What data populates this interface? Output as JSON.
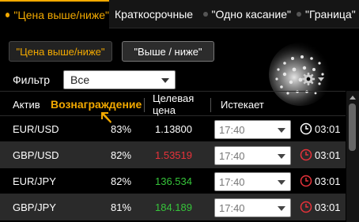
{
  "tabs": [
    {
      "label": "\"Цена выше/ниже\"",
      "active": true
    },
    {
      "label": "Краткосрочные"
    },
    {
      "label": "\"Одно касание\""
    },
    {
      "label": "\"Граница\""
    }
  ],
  "buttons": {
    "primary_label": "\"Цена выше/ниже\"",
    "secondary_label": "\"Выше / ниже\""
  },
  "filter": {
    "label": "Фильтр",
    "value": "Все"
  },
  "table": {
    "headers": {
      "asset": "Актив",
      "reward": "Вознаграждение",
      "price_line1": "Целевая",
      "price_line2": "цена",
      "expires": "Истекает"
    },
    "rows": [
      {
        "asset": "EUR/USD",
        "payout": "83%",
        "price": "1.13800",
        "price_color": "#ffffff",
        "expiry": "17:40",
        "timer": "03:01",
        "timer_icon_color": "#ffffff"
      },
      {
        "asset": "GBP/USD",
        "payout": "82%",
        "price": "1.53519",
        "price_color": "#e8323a",
        "expiry": "17:40",
        "timer": "03:01",
        "timer_icon_color": "#e8323a"
      },
      {
        "asset": "EUR/JPY",
        "payout": "82%",
        "price": "136.534",
        "price_color": "#36c43a",
        "expiry": "17:40",
        "timer": "03:01",
        "timer_icon_color": "#e8323a"
      },
      {
        "asset": "GBP/JPY",
        "payout": "81%",
        "price": "184.189",
        "price_color": "#36c43a",
        "expiry": "17:40",
        "timer": "03:01",
        "timer_icon_color": "#e8323a"
      }
    ]
  },
  "icons": {
    "settings": "gear-icon",
    "timer": "clock-icon",
    "logo": "globe-icon",
    "pointer": "pointer-arrow-icon"
  },
  "colors": {
    "accent": "#f2a900",
    "down": "#e8323a",
    "up": "#36c43a"
  }
}
